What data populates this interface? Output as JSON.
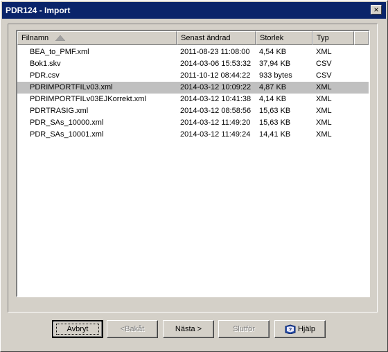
{
  "window": {
    "title": "PDR124 - Import",
    "close_glyph": "×"
  },
  "list": {
    "columns": [
      "Filnamn",
      "Senast ändrad",
      "Storlek",
      "Typ"
    ],
    "sort_column": "Filnamn",
    "selected_index": 3,
    "rows": [
      {
        "name": "BEA_to_PMF.xml",
        "modified": "2011-08-23 11:08:00",
        "size": "4,54 KB",
        "type": "XML"
      },
      {
        "name": "Bok1.skv",
        "modified": "2014-03-06 15:53:32",
        "size": "37,94 KB",
        "type": "CSV"
      },
      {
        "name": "PDR.csv",
        "modified": "2011-10-12 08:44:22",
        "size": "933 bytes",
        "type": "CSV"
      },
      {
        "name": "PDRIMPORTFILv03.xml",
        "modified": "2014-03-12 10:09:22",
        "size": "4,87 KB",
        "type": "XML"
      },
      {
        "name": "PDRIMPORTFILv03EJKorrekt.xml",
        "modified": "2014-03-12 10:41:38",
        "size": "4,14 KB",
        "type": "XML"
      },
      {
        "name": "PDRTRASIG.xml",
        "modified": "2014-03-12 08:58:56",
        "size": "15,63 KB",
        "type": "XML"
      },
      {
        "name": "PDR_SAs_10000.xml",
        "modified": "2014-03-12 11:49:20",
        "size": "15,63 KB",
        "type": "XML"
      },
      {
        "name": "PDR_SAs_10001.xml",
        "modified": "2014-03-12 11:49:24",
        "size": "14,41 KB",
        "type": "XML"
      }
    ]
  },
  "buttons": {
    "cancel": "Avbryt",
    "back": "<Bakåt",
    "next": "Nästa >",
    "finish": "Slutför",
    "help": "Hjälp"
  },
  "colors": {
    "titlebar": "#0a246a",
    "selection": "#c0c0c0",
    "face": "#d4d0c8"
  },
  "icons": {
    "help": "help-book-icon",
    "sort": "sort-ascending-icon",
    "close": "close-icon"
  }
}
